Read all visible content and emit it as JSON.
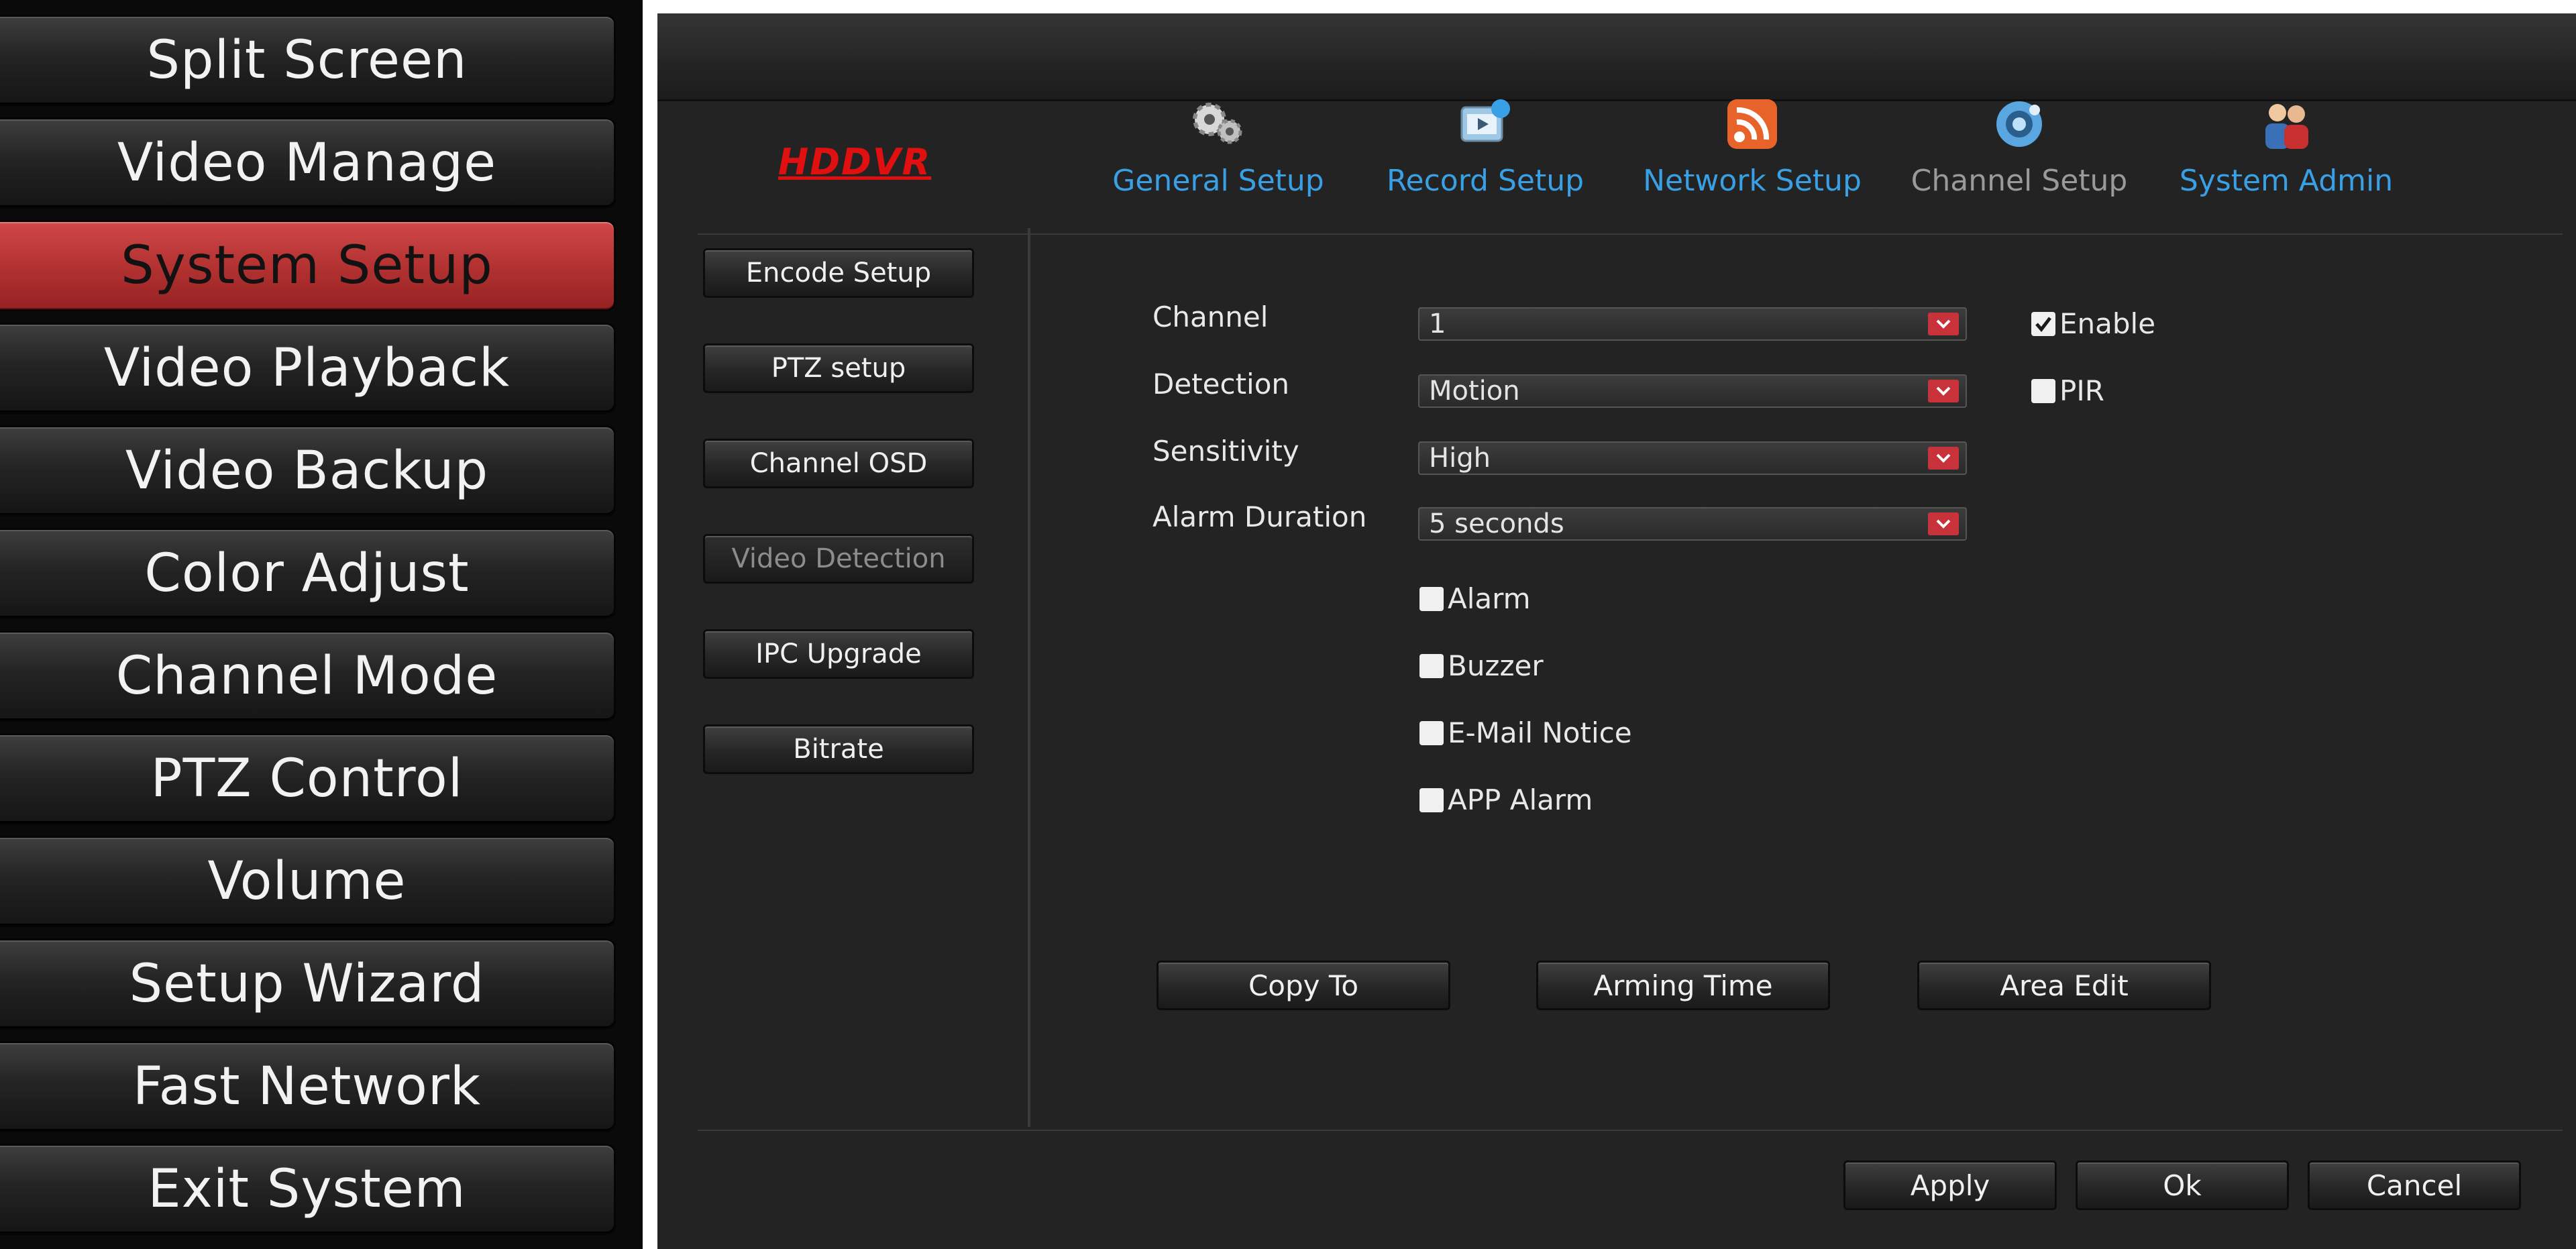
{
  "left_menu": {
    "items": [
      {
        "label": "Split Screen"
      },
      {
        "label": "Video Manage"
      },
      {
        "label": "System Setup",
        "active": true
      },
      {
        "label": "Video Playback"
      },
      {
        "label": "Video Backup"
      },
      {
        "label": "Color Adjust"
      },
      {
        "label": "Channel Mode"
      },
      {
        "label": "PTZ Control"
      },
      {
        "label": "Volume"
      },
      {
        "label": "Setup Wizard"
      },
      {
        "label": "Fast Network"
      },
      {
        "label": "Exit System"
      }
    ],
    "active_color": "#b43232"
  },
  "header": {
    "logo": "HDDVR",
    "logo_color": "#e01010",
    "tabs": [
      {
        "label": "General Setup",
        "icon": "gears-icon"
      },
      {
        "label": "Record Setup",
        "icon": "film-icon"
      },
      {
        "label": "Network Setup",
        "icon": "wifi-icon"
      },
      {
        "label": "Channel Setup",
        "icon": "camera-icon",
        "current": true
      },
      {
        "label": "System Admin",
        "icon": "users-icon"
      }
    ],
    "tab_color": "#3aa0e6"
  },
  "sub_nav": {
    "items": [
      {
        "label": "Encode Setup"
      },
      {
        "label": "PTZ setup"
      },
      {
        "label": "Channel OSD"
      },
      {
        "label": "Video Detection",
        "current": true
      },
      {
        "label": "IPC Upgrade"
      },
      {
        "label": "Bitrate"
      }
    ]
  },
  "form": {
    "channel": {
      "label": "Channel",
      "value": "1"
    },
    "detection": {
      "label": "Detection",
      "value": "Motion"
    },
    "sensitivity": {
      "label": "Sensitivity",
      "value": "High"
    },
    "alarm_duration": {
      "label": "Alarm Duration",
      "value": "5 seconds"
    },
    "enable": {
      "label": "Enable",
      "checked": true
    },
    "pir": {
      "label": "PIR",
      "checked": false
    },
    "alarm": {
      "label": "Alarm",
      "checked": false
    },
    "buzzer": {
      "label": "Buzzer",
      "checked": false
    },
    "email_notice": {
      "label": "E-Mail Notice",
      "checked": false
    },
    "app_alarm": {
      "label": "APP Alarm",
      "checked": false
    }
  },
  "actions": {
    "copy_to": "Copy To",
    "arming_time": "Arming Time",
    "area_edit": "Area Edit"
  },
  "footer": {
    "apply": "Apply",
    "ok": "Ok",
    "cancel": "Cancel"
  }
}
